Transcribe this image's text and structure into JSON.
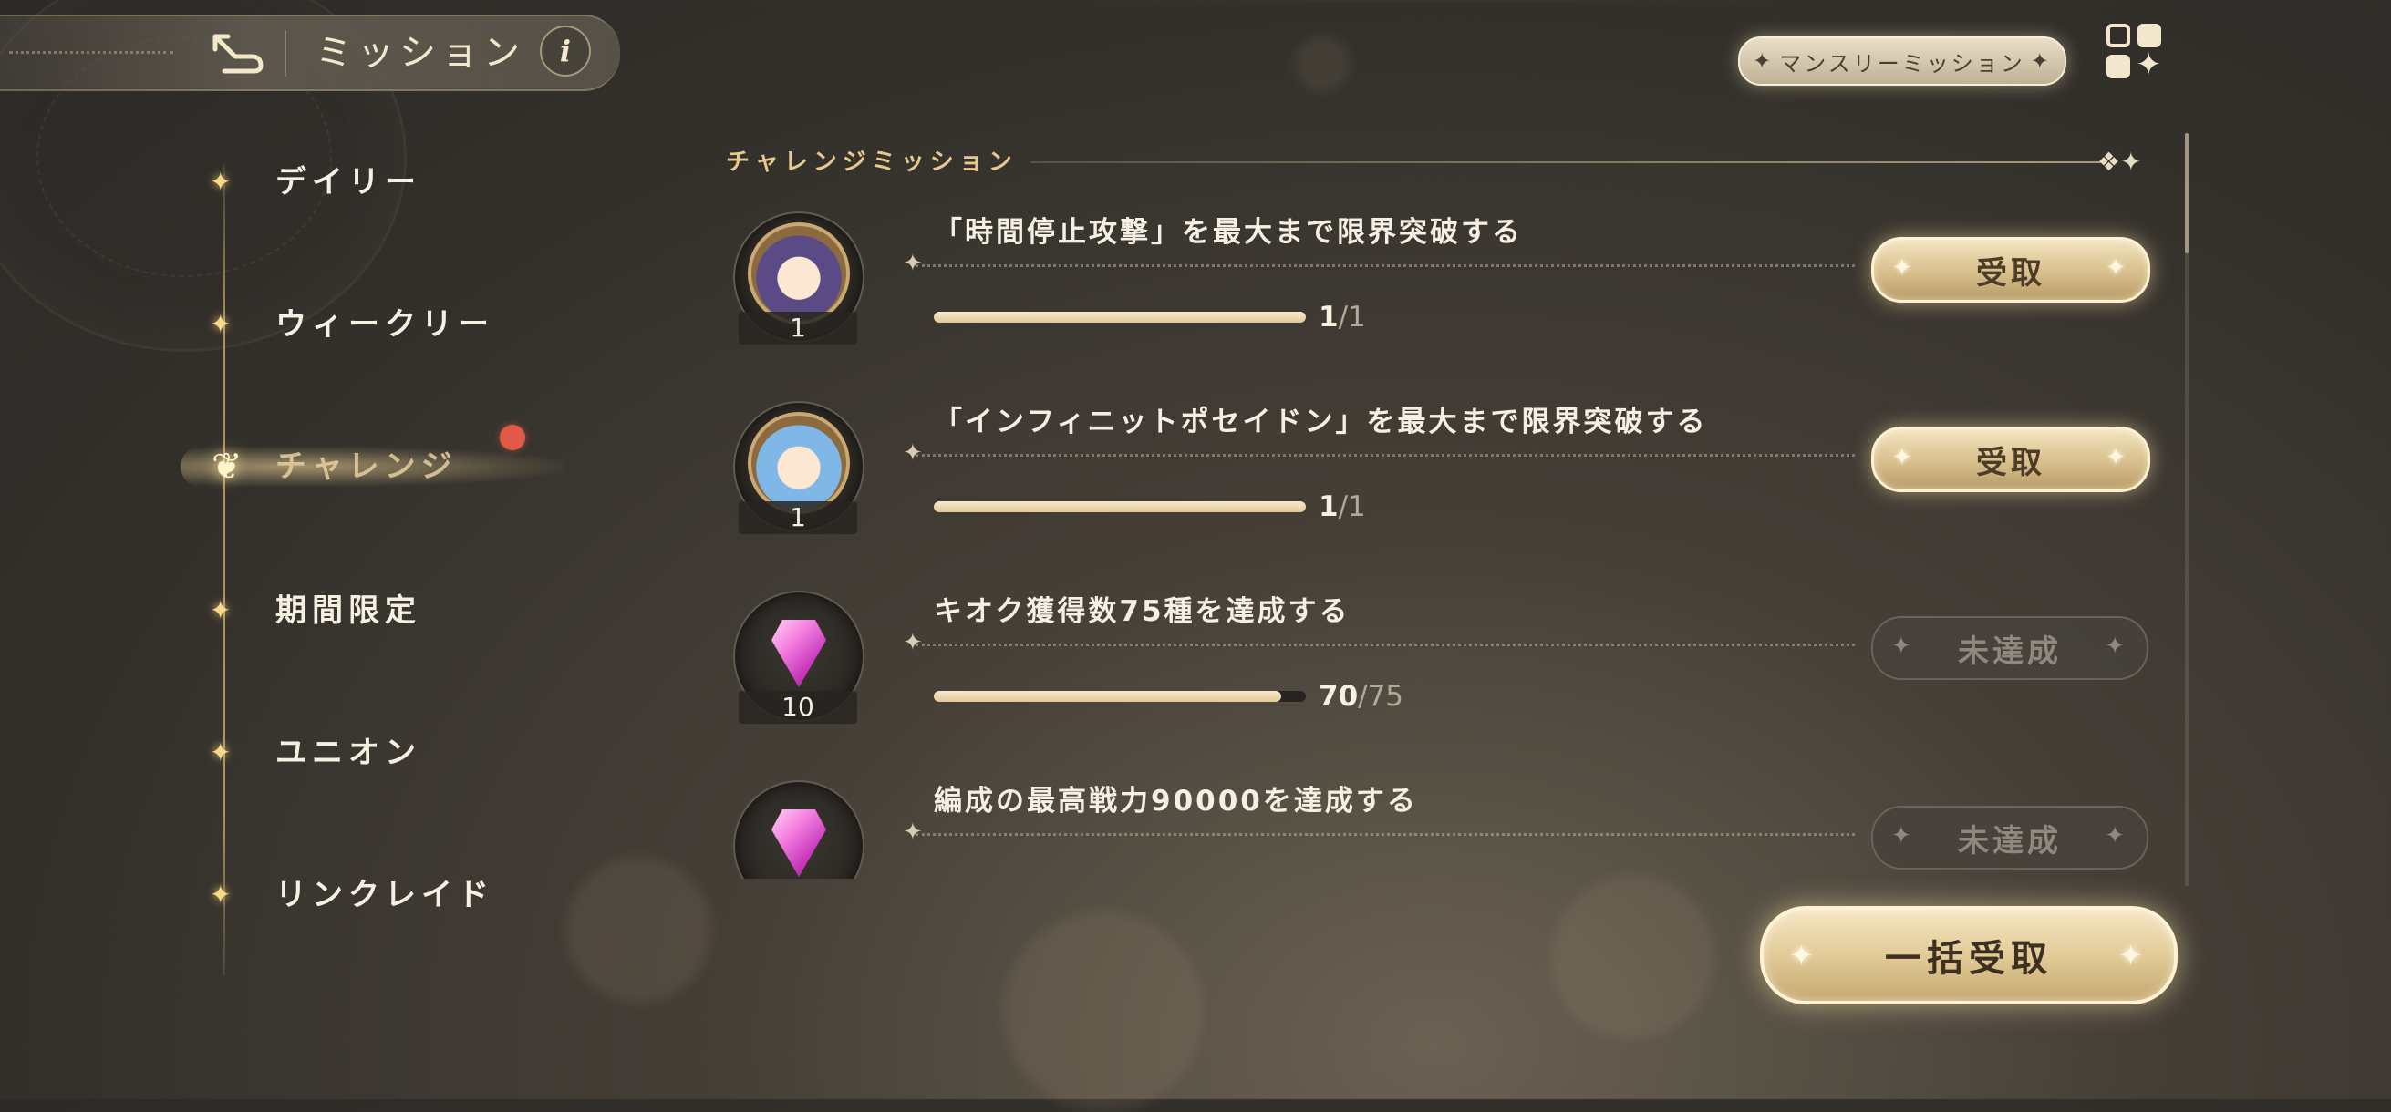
{
  "header": {
    "title": "ミッション",
    "info_label": "i",
    "back_icon": "back-arrow-icon"
  },
  "top_right": {
    "monthly_label": "マンスリーミッション",
    "menu_icon": "grid-menu-icon"
  },
  "sidebar": {
    "items": [
      {
        "label": "デイリー",
        "active": false
      },
      {
        "label": "ウィークリー",
        "active": false
      },
      {
        "label": "チャレンジ",
        "active": true,
        "badge": true
      },
      {
        "label": "期間限定",
        "active": false
      },
      {
        "label": "ユニオン",
        "active": false
      },
      {
        "label": "リンクレイド",
        "active": false
      }
    ]
  },
  "section": {
    "title": "チャレンジミッション"
  },
  "missions": [
    {
      "title": "「時間停止攻撃」を最大まで限界突破する",
      "reward_type": "character",
      "reward_count": "1",
      "progress_current": "1",
      "progress_sep_total": "/1",
      "progress_fraction": 1.0,
      "status": "claim",
      "button_label": "受取"
    },
    {
      "title": "「インフィニットポセイドン」を最大まで限界突破する",
      "reward_type": "character",
      "reward_count": "1",
      "progress_current": "1",
      "progress_sep_total": "/1",
      "progress_fraction": 1.0,
      "status": "claim",
      "button_label": "受取"
    },
    {
      "title": "キオク獲得数75種を達成する",
      "reward_type": "gem",
      "reward_count": "10",
      "progress_current": "70",
      "progress_sep_total": "/75",
      "progress_fraction": 0.933,
      "status": "pending",
      "button_label": "未達成"
    },
    {
      "title": "編成の最高戦力90000を達成する",
      "reward_type": "gem",
      "reward_count": "",
      "progress_current": "",
      "progress_sep_total": "",
      "progress_fraction": 0,
      "status": "pending",
      "button_label": "未達成"
    }
  ],
  "bulk": {
    "label": "一括受取"
  },
  "colors": {
    "accent_gold": "#e7c88d",
    "badge_red": "#e05a47",
    "bar_fill": "#f7e9cb"
  }
}
